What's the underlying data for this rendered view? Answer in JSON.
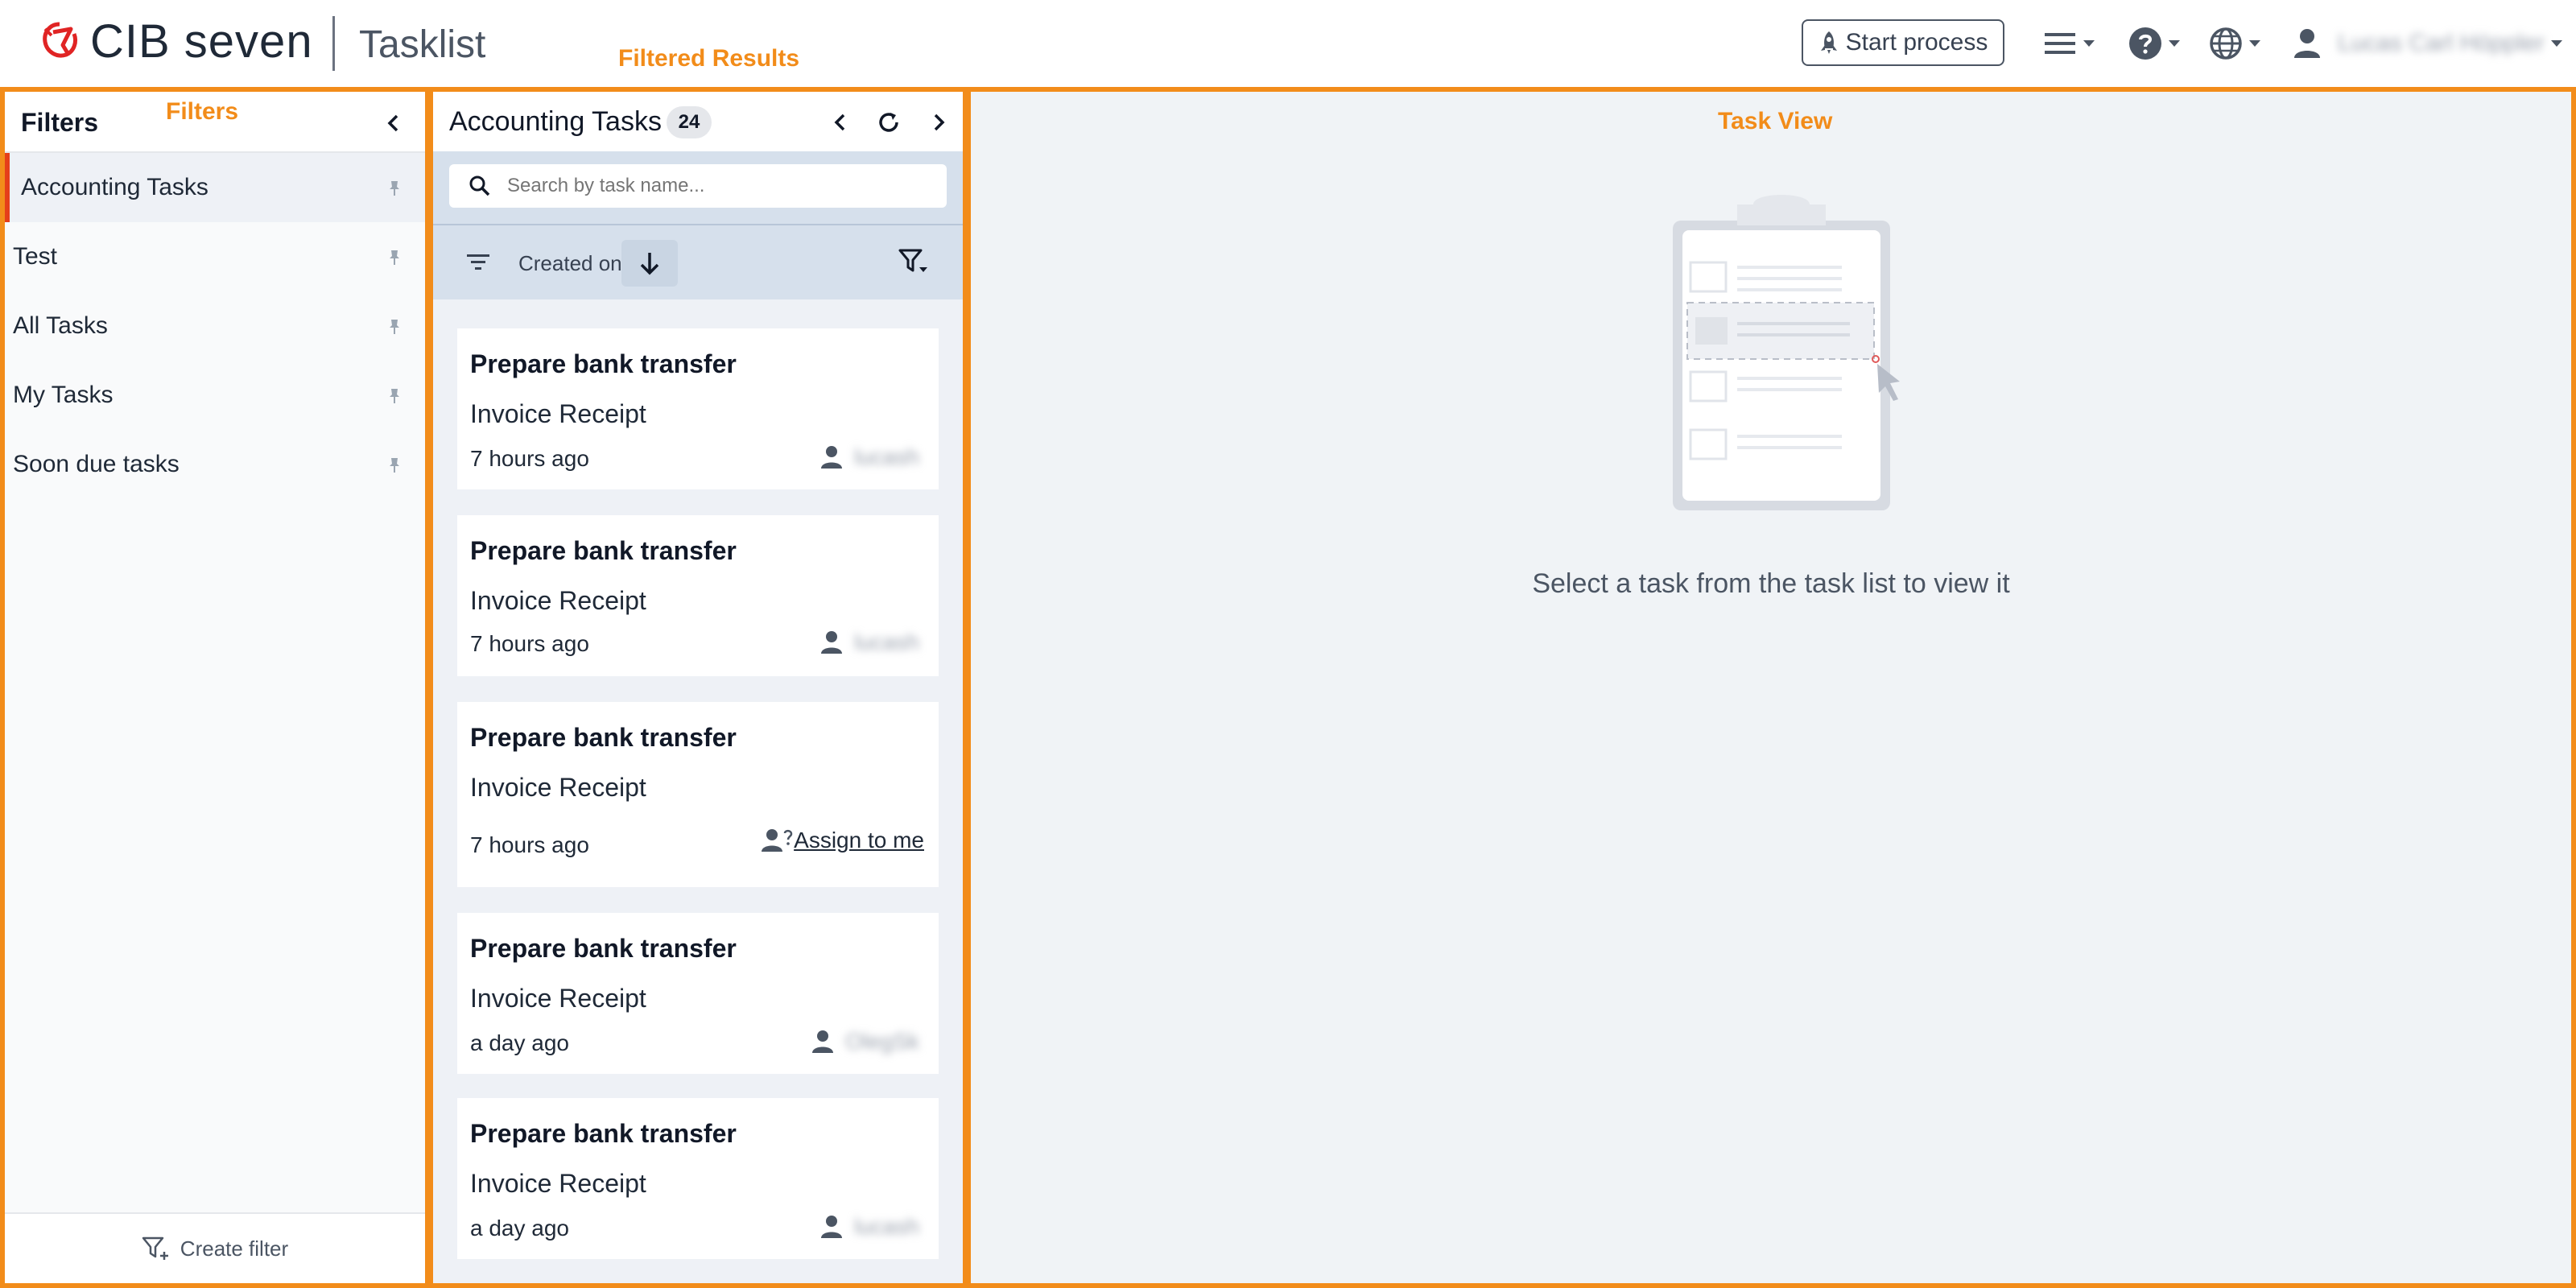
{
  "header": {
    "brand": "CIB seven",
    "app_title": "Tasklist",
    "annotation": "Filtered Results",
    "start_process_label": "Start process",
    "icons": [
      "rocket-icon",
      "menu-icon",
      "help-icon",
      "globe-icon",
      "user-icon"
    ],
    "user_name": "Lucas Carl Höppler"
  },
  "filters": {
    "title": "Filters",
    "annotation": "Filters",
    "items": [
      {
        "label": "Accounting Tasks",
        "active": true
      },
      {
        "label": "Test"
      },
      {
        "label": "All Tasks"
      },
      {
        "label": "My Tasks"
      },
      {
        "label": "Soon due tasks"
      }
    ],
    "create_label": "Create filter"
  },
  "tasklist": {
    "title": "Accounting Tasks",
    "count": "24",
    "search_placeholder": "Search by task name...",
    "sort_label": "Created on",
    "cards": [
      {
        "name": "Prepare bank transfer",
        "process": "Invoice Receipt",
        "time": "7 hours ago",
        "assignee": "lucash"
      },
      {
        "name": "Prepare bank transfer",
        "process": "Invoice Receipt",
        "time": "7 hours ago",
        "assignee": "lucash"
      },
      {
        "name": "Prepare bank transfer",
        "process": "Invoice Receipt",
        "time": "7 hours ago",
        "assign_label": "Assign to me"
      },
      {
        "name": "Prepare bank transfer",
        "process": "Invoice Receipt",
        "time": "a day ago",
        "assignee": "OlegSk"
      },
      {
        "name": "Prepare bank transfer",
        "process": "Invoice Receipt",
        "time": "a day ago",
        "assignee": "lucash"
      }
    ]
  },
  "taskview": {
    "annotation": "Task View",
    "message": "Select a task from the task list to view it"
  },
  "colors": {
    "annotation": "#f28c1a",
    "active_marker": "#e53e1a",
    "logo": "#e02424"
  }
}
